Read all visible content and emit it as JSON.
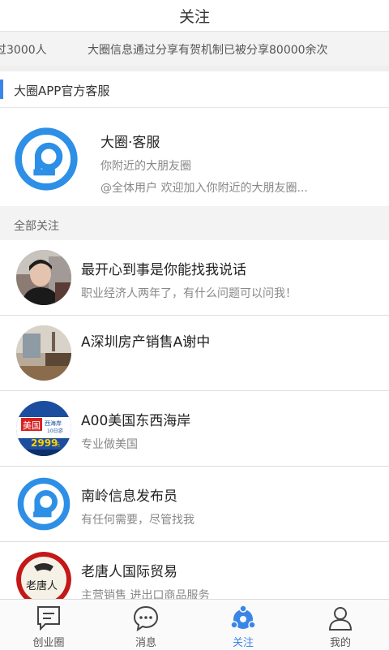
{
  "header": {
    "title": "关注"
  },
  "ticker": {
    "items": [
      "过3000人",
      "大圈信息通过分享有贺机制已被分享80000余次"
    ]
  },
  "service": {
    "section_label": "大圈APP官方客服",
    "name": "大圈·客服",
    "subtitle": "你附近的大朋友圈",
    "description": "@全体用户 欢迎加入你附近的大朋友圈..."
  },
  "all_follow": {
    "section_label": "全部关注"
  },
  "follows": [
    {
      "name": "最开心到事是你能找我说话",
      "desc": "职业经济人两年了，有什么问题可以问我！",
      "avatar_icon": "person-photo"
    },
    {
      "name": "A深圳房产销售A谢中",
      "desc": "",
      "avatar_icon": "room-photo"
    },
    {
      "name": "A00美国东西海岸",
      "desc": "专业做美国",
      "avatar_icon": "travel-ad",
      "avatar_text": {
        "country": "美国",
        "tag": "西海岸",
        "days": "10日游",
        "price": "2999",
        "unit": "元"
      }
    },
    {
      "name": "南岭信息发布员",
      "desc": "有任何需要，尽管找我",
      "avatar_icon": "app-logo"
    },
    {
      "name": "老唐人国际贸易",
      "desc": "主营销售 进出口商品服务",
      "avatar_icon": "shop-logo",
      "avatar_text": {
        "logo": "老唐人"
      }
    }
  ],
  "tabbar": {
    "tabs": [
      {
        "label": "创业圈",
        "icon": "chat-square-icon",
        "active": false
      },
      {
        "label": "消息",
        "icon": "message-bubble-icon",
        "active": false
      },
      {
        "label": "关注",
        "icon": "follow-nodes-icon",
        "active": true
      },
      {
        "label": "我的",
        "icon": "person-icon",
        "active": false
      }
    ]
  },
  "colors": {
    "accent": "#3a86e8",
    "background": "#efefef"
  }
}
